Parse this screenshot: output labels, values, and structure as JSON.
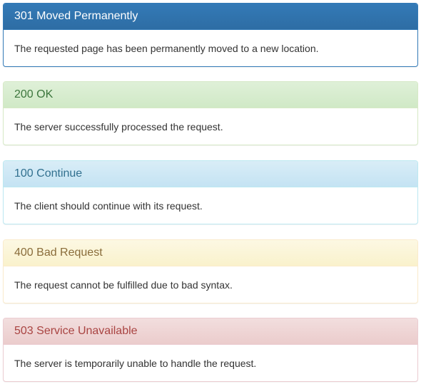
{
  "panels": [
    {
      "variant": "primary",
      "title": "301 Moved Permanently",
      "body": "The requested page has been permanently moved to a new location.",
      "heading_color": "#337ab7",
      "text_color": "#ffffff"
    },
    {
      "variant": "success",
      "title": "200 OK",
      "body": "The server successfully processed the request.",
      "heading_color": "#dff0d8",
      "text_color": "#3c763d"
    },
    {
      "variant": "info",
      "title": "100 Continue",
      "body": "The client should continue with its request.",
      "heading_color": "#d9edf7",
      "text_color": "#31708f"
    },
    {
      "variant": "warning",
      "title": "400 Bad Request",
      "body": "The request cannot be fulfilled due to bad syntax.",
      "heading_color": "#fcf8e3",
      "text_color": "#8a6d3b"
    },
    {
      "variant": "danger",
      "title": "503 Service Unavailable",
      "body": "The server is temporarily unable to handle the request.",
      "heading_color": "#f2dede",
      "text_color": "#a94442"
    }
  ]
}
